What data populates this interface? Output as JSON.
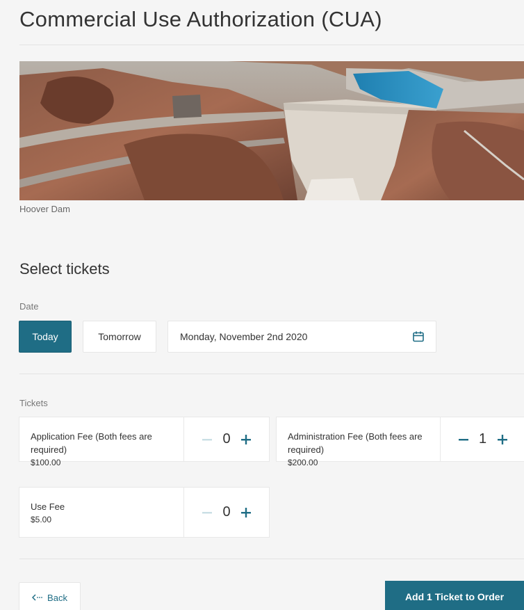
{
  "page": {
    "title": "Commercial Use Authorization (CUA)",
    "image_caption": "Hoover Dam"
  },
  "select": {
    "heading": "Select tickets",
    "date_label": "Date",
    "today_label": "Today",
    "tomorrow_label": "Tomorrow",
    "date_value": "Monday, November 2nd 2020",
    "tickets_label": "Tickets"
  },
  "tickets": [
    {
      "name": "Application Fee (Both fees are required)",
      "price": "$100.00",
      "quantity": "0"
    },
    {
      "name": "Administration Fee (Both fees are required)",
      "price": "$200.00",
      "quantity": "1"
    },
    {
      "name": "Use Fee",
      "price": "$5.00",
      "quantity": "0"
    }
  ],
  "footer": {
    "back_label": "Back",
    "add_label": "Add 1 Ticket to Order"
  },
  "colors": {
    "accent": "#1f6d85",
    "disabled_stepper": "#c9dfe5"
  }
}
